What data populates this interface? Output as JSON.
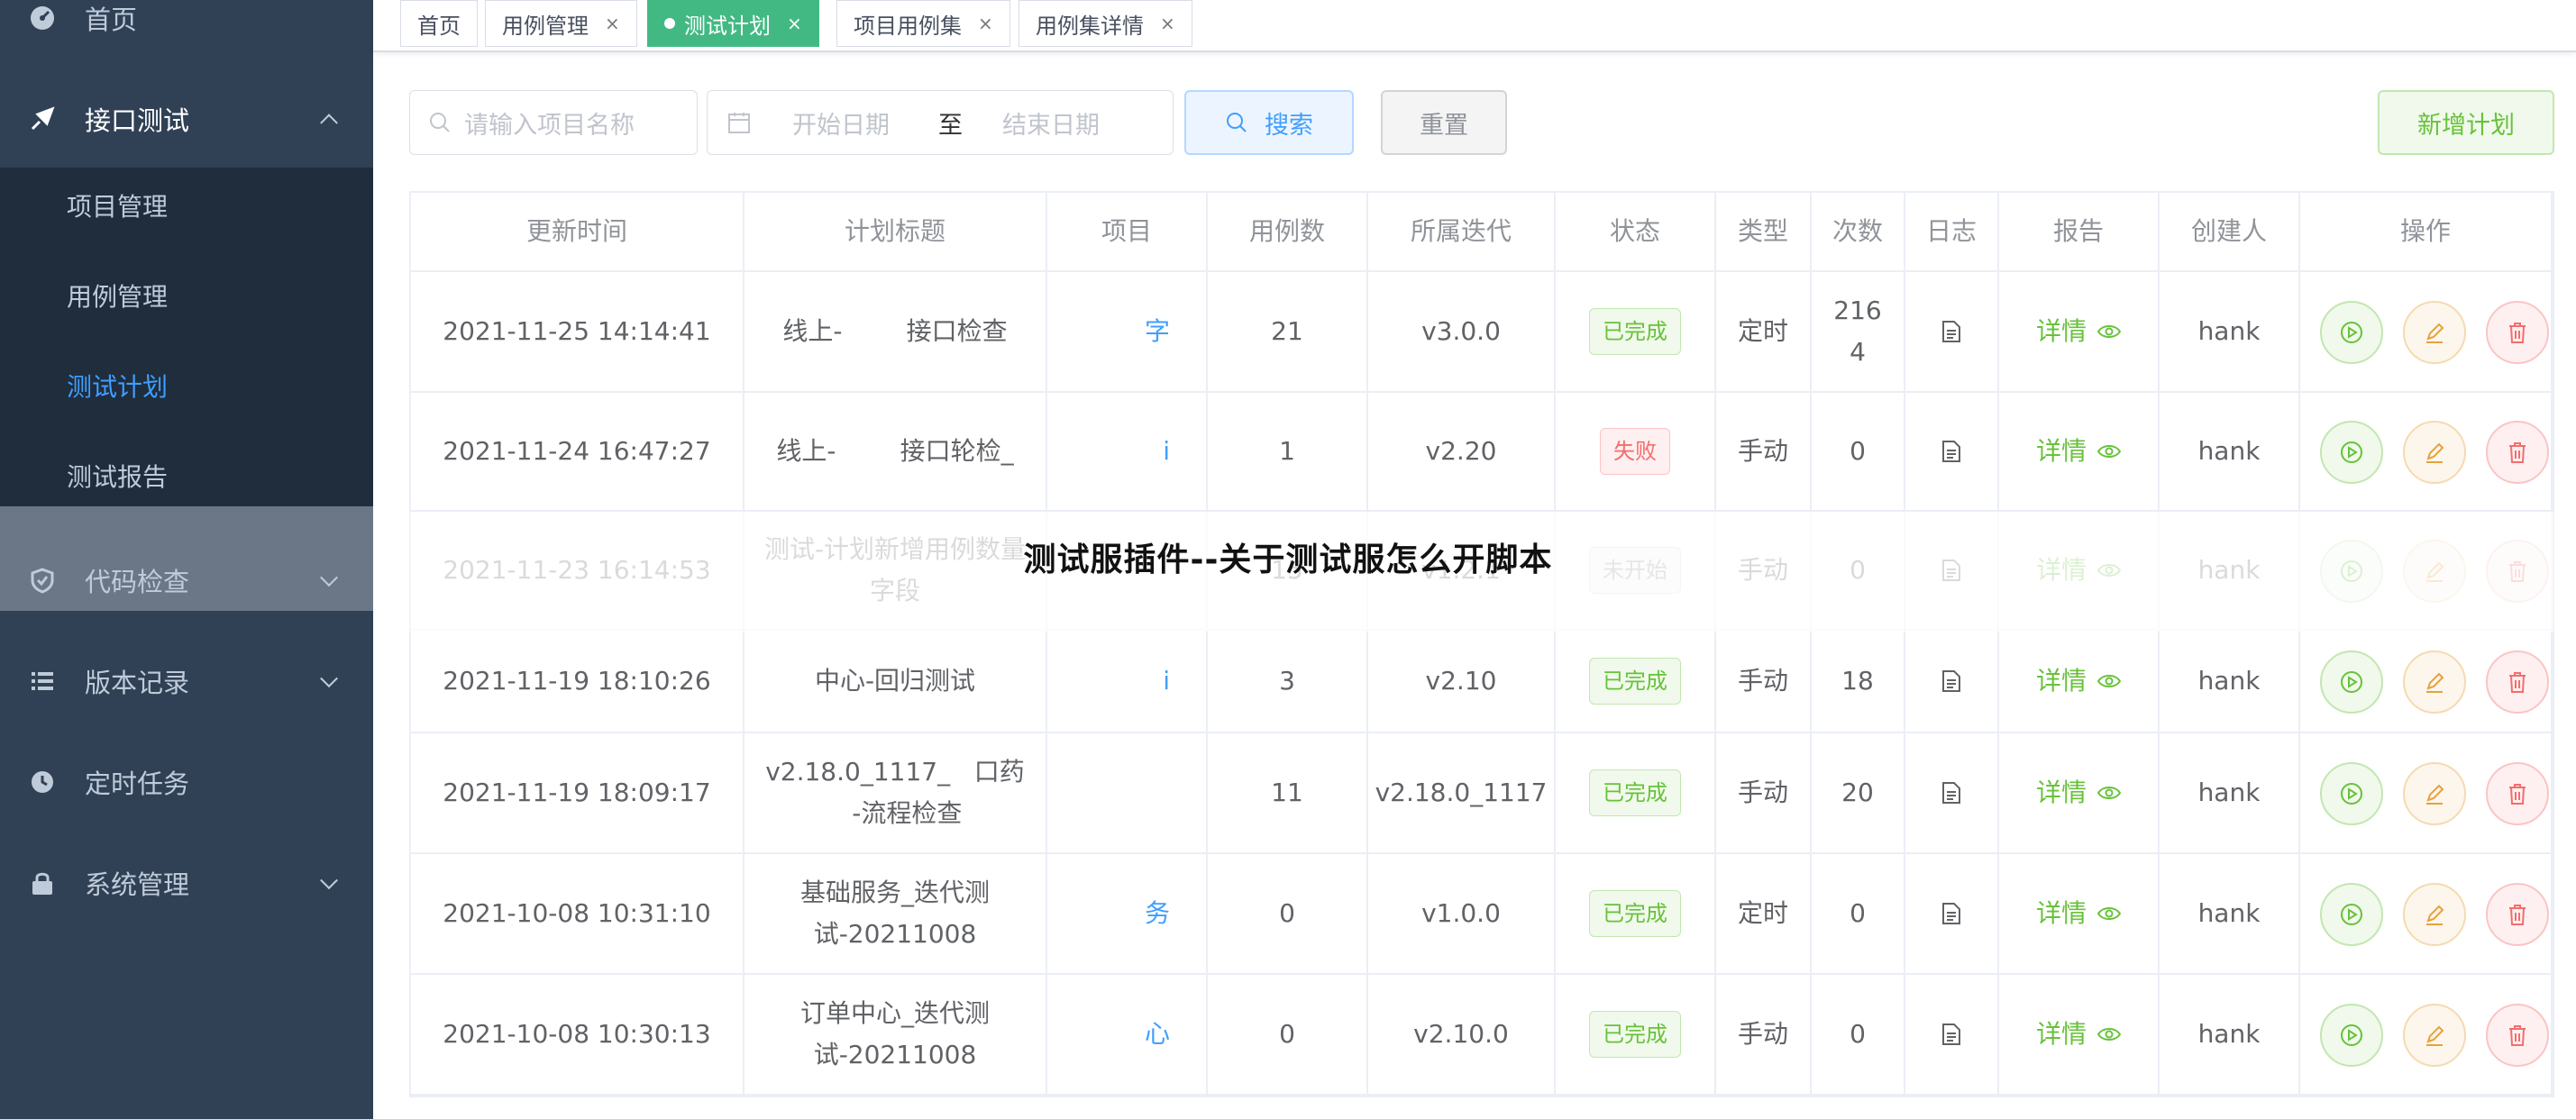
{
  "sidebar": {
    "items": [
      {
        "label": "首页",
        "icon": "dashboard-icon"
      },
      {
        "label": "接口测试",
        "icon": "send-icon"
      },
      {
        "label": "代码检查",
        "icon": "shield-icon"
      },
      {
        "label": "版本记录",
        "icon": "list-icon"
      },
      {
        "label": "定时任务",
        "icon": "clock-icon"
      },
      {
        "label": "系统管理",
        "icon": "lock-icon"
      }
    ],
    "sub_items": [
      {
        "label": "项目管理"
      },
      {
        "label": "用例管理"
      },
      {
        "label": "测试计划"
      },
      {
        "label": "测试报告"
      }
    ]
  },
  "tabs": [
    {
      "label": "首页"
    },
    {
      "label": "用例管理",
      "close": "×"
    },
    {
      "label": "测试计划",
      "close": "×"
    },
    {
      "label": "项目用例集",
      "close": "×"
    },
    {
      "label": "用例集详情",
      "close": "×"
    }
  ],
  "filters": {
    "project_placeholder": "请输入项目名称",
    "start_date_placeholder": "开始日期",
    "range_separator": "至",
    "end_date_placeholder": "结束日期",
    "search_label": "搜索",
    "reset_label": "重置",
    "add_label": "新增计划"
  },
  "table": {
    "headers": [
      "更新时间",
      "计划标题",
      "项目",
      "用例数",
      "所属迭代",
      "状态",
      "类型",
      "次数",
      "日志",
      "报告",
      "创建人",
      "操作"
    ],
    "report_label": "详情",
    "rows": [
      {
        "time": "2021-11-25 14:14:41",
        "title": "线上-        接口检查",
        "project": "字",
        "cases": "21",
        "iteration": "v3.0.0",
        "status": "已完成",
        "type": "定时",
        "count": "216\n4",
        "creator": "hank"
      },
      {
        "time": "2021-11-24 16:47:27",
        "title": "线上-        接口轮检_",
        "project": "i",
        "cases": "1",
        "iteration": "v2.20",
        "status": "失败",
        "type": "手动",
        "count": "0",
        "creator": "hank"
      },
      {
        "time": "2021-11-23 16:14:53",
        "title": "测试-计划新增用例数量字段",
        "project": "",
        "cases": "15",
        "iteration": "v1.2.1",
        "status": "未开始",
        "type": "手动",
        "count": "0",
        "creator": "hank"
      },
      {
        "time": "2021-11-19 18:10:26",
        "title": "中心-回归测试",
        "project": "i",
        "cases": "3",
        "iteration": "v2.10",
        "status": "已完成",
        "type": "手动",
        "count": "18",
        "creator": "hank"
      },
      {
        "time": "2021-11-19 18:09:17",
        "title": "v2.18.0_1117_   口药\n   -流程检查",
        "project": "",
        "cases": "11",
        "iteration": "v2.18.0_1117",
        "status": "已完成",
        "type": "手动",
        "count": "20",
        "creator": "hank"
      },
      {
        "time": "2021-10-08 10:31:10",
        "title": "基础服务_迭代测试-20211008",
        "project": "务",
        "cases": "0",
        "iteration": "v1.0.0",
        "status": "已完成",
        "type": "定时",
        "count": "0",
        "creator": "hank"
      },
      {
        "time": "2021-10-08 10:30:13",
        "title": "订单中心_迭代测试-20211008",
        "project": "心",
        "cases": "0",
        "iteration": "v2.10.0",
        "status": "已完成",
        "type": "手动",
        "count": "0",
        "creator": "hank"
      }
    ]
  },
  "watermark": "测试服插件--关于测试服怎么开脚本",
  "colors": {
    "sidebar_bg": "#304156",
    "active_tab": "#42b983",
    "link_blue": "#409eff",
    "success": "#67c23a"
  }
}
